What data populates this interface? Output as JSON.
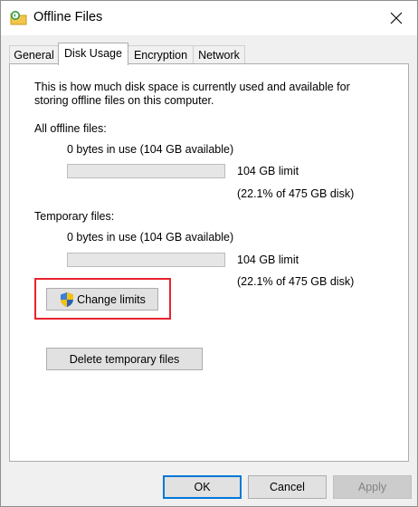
{
  "window": {
    "title": "Offline Files",
    "icon": "offline-files-icon",
    "close_icon": "close-icon"
  },
  "tabs": [
    {
      "label": "General",
      "active": false
    },
    {
      "label": "Disk Usage",
      "active": true
    },
    {
      "label": "Encryption",
      "active": false
    },
    {
      "label": "Network",
      "active": false
    }
  ],
  "disk_usage": {
    "description_line1": "This is how much disk space is currently used and available for",
    "description_line2": "storing offline files on this computer.",
    "all_offline": {
      "heading": "All offline files:",
      "usage_text": "0 bytes in use (104 GB available)",
      "limit_text": "104 GB limit",
      "percent_text": "(22.1% of 475 GB disk)",
      "used_fraction": 0
    },
    "temporary": {
      "heading": "Temporary files:",
      "usage_text": "0 bytes in use (104 GB available)",
      "limit_text": "104 GB limit",
      "percent_text": "(22.1% of 475 GB disk)",
      "used_fraction": 0
    },
    "change_limits_label": "Change limits",
    "change_limits_icon": "uac-shield-icon",
    "delete_temp_label": "Delete temporary files"
  },
  "footer": {
    "ok_label": "OK",
    "cancel_label": "Cancel",
    "apply_label": "Apply"
  },
  "colors": {
    "highlight": "#e8232d",
    "default_button_border": "#0078d7"
  }
}
